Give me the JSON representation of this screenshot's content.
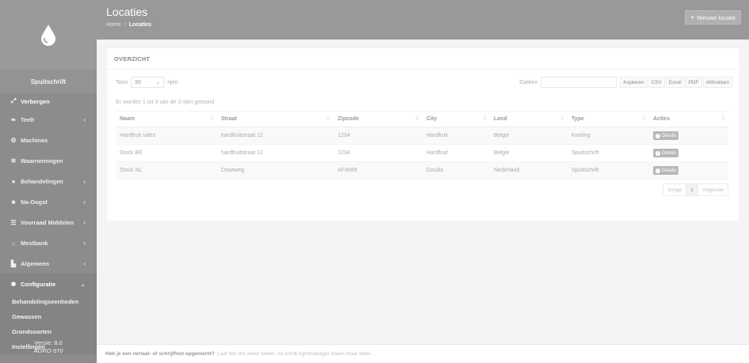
{
  "sidebar": {
    "brand": "Spuitschrift",
    "menu": [
      {
        "label": "Verbergen",
        "icon": "collapse-icon",
        "has_children": false
      },
      {
        "label": "Teelt",
        "icon": "leaf-icon",
        "has_children": true
      },
      {
        "label": "Machines",
        "icon": "tractor-icon",
        "has_children": false
      },
      {
        "label": "Waarnemingen",
        "icon": "bug-icon",
        "has_children": false
      },
      {
        "label": "Behandelingen",
        "icon": "drop-icon",
        "has_children": true
      },
      {
        "label": "Na-Oogst",
        "icon": "box-icon",
        "has_children": true
      },
      {
        "label": "Voorraad Middelen",
        "icon": "list-icon",
        "has_children": true
      },
      {
        "label": "Mestbank",
        "icon": "bank-icon",
        "has_children": true
      },
      {
        "label": "Algemeen",
        "icon": "chart-icon",
        "has_children": true
      },
      {
        "label": "Configuratie",
        "icon": "gear-icon",
        "has_children": true
      }
    ],
    "submenu": [
      "Behandelingseenheden",
      "Gewassen",
      "Grondsoorten",
      "Instellingen"
    ],
    "version_line1": "Versie: 8.0",
    "version_line2": "AGRO-970"
  },
  "header": {
    "title": "Locaties",
    "breadcrumb_home": "Home",
    "breadcrumb_sep": "/",
    "breadcrumb_current": "Locaties",
    "new_button": "Nieuwe locatie"
  },
  "panel": {
    "title": "OVERZICHT",
    "show_prefix": "Toon",
    "show_value": "50",
    "show_suffix": "rijen",
    "search_label": "Zoeken",
    "search_value": "",
    "export_buttons": [
      "Kopieren",
      "CSV",
      "Excel",
      "PDF",
      "Afdrukken"
    ],
    "info": "Er worden 1 tot 3 van de 3 rijen getoond",
    "columns": [
      "Naam",
      "Straat",
      "Zipcode",
      "City",
      "Land",
      "Type",
      "Acties"
    ],
    "rows": [
      [
        "Hardfruit sales",
        "hardfruitstraat 12",
        "1234",
        "Hardfruit",
        "Belgie",
        "Koeling",
        "Details"
      ],
      [
        "Stock BE",
        "hardfruitstraat 12",
        "1234",
        "Hardfruit",
        "Belgie",
        "Spuitschrift",
        "Details"
      ],
      [
        "Stock NL",
        "Osseweg",
        "AF4589",
        "Gouda",
        "Nederland",
        "Spuitschrift",
        "Details"
      ]
    ],
    "pager": {
      "prev": "Vorige",
      "page": "1",
      "next": "Volgende"
    }
  },
  "footer": {
    "strong": "Heb je een vertaal- of schrijffout opgemerkt?",
    "text": "Laat het ons zeker weten, zo wordt Agromanager alleen maar beter."
  }
}
